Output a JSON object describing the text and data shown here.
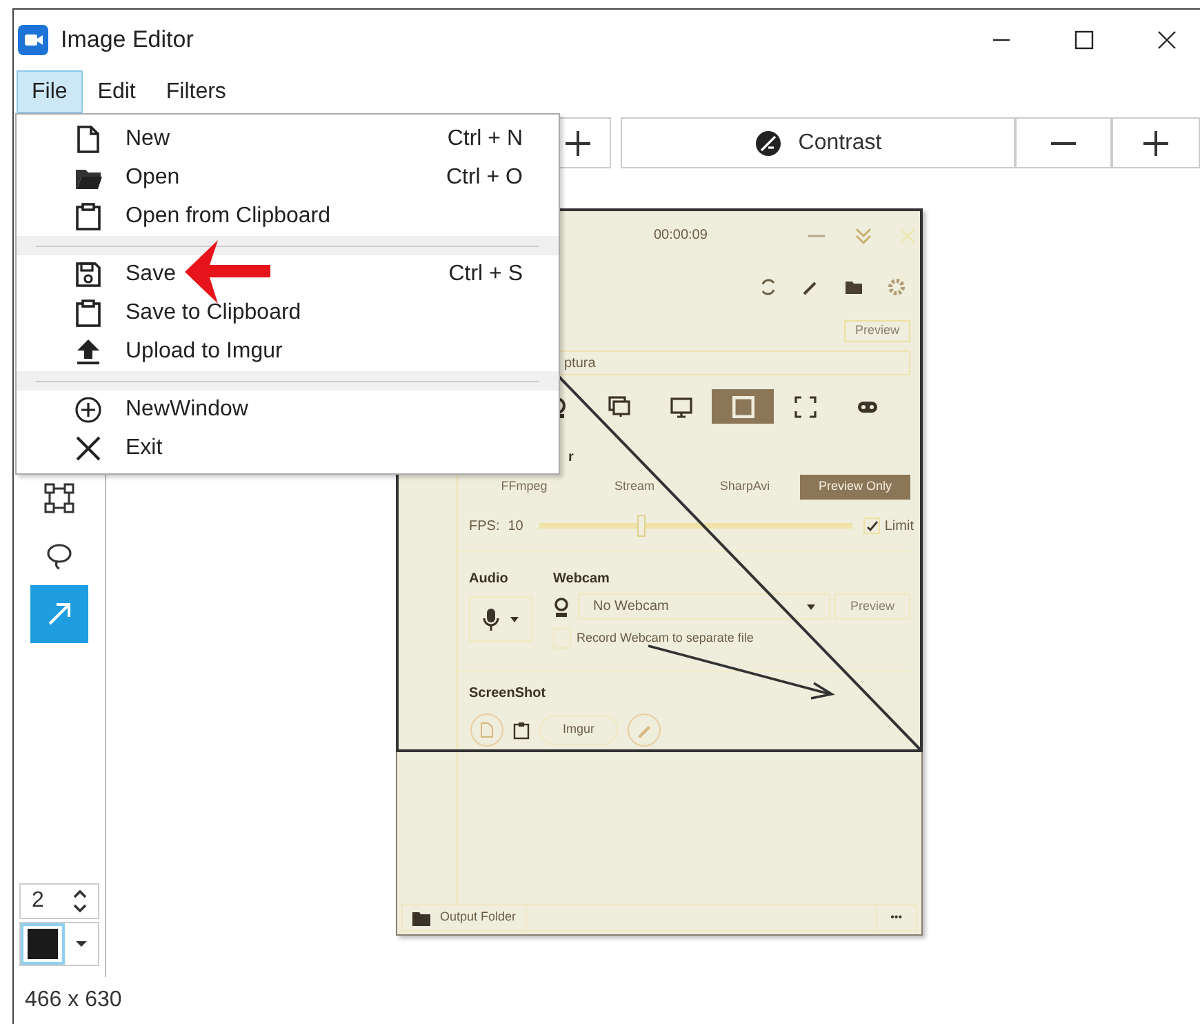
{
  "window": {
    "title": "Image Editor"
  },
  "menu_bar": [
    {
      "label": "File",
      "selected": true
    },
    {
      "label": "Edit",
      "selected": false
    },
    {
      "label": "Filters",
      "selected": false
    }
  ],
  "file_menu": [
    {
      "kind": "item",
      "label": "New",
      "shortcut": "Ctrl + N"
    },
    {
      "kind": "item",
      "label": "Open",
      "shortcut": "Ctrl + O"
    },
    {
      "kind": "item",
      "label": "Open from Clipboard"
    },
    {
      "kind": "separator"
    },
    {
      "kind": "item",
      "label": "Save",
      "shortcut": "Ctrl + S"
    },
    {
      "kind": "item",
      "label": "Save to Clipboard"
    },
    {
      "kind": "item",
      "label": "Upload to Imgur"
    },
    {
      "kind": "separator"
    },
    {
      "kind": "item",
      "label": "NewWindow"
    },
    {
      "kind": "item",
      "label": "Exit"
    }
  ],
  "toolbar": {
    "contrast_label": "Contrast"
  },
  "tools": [
    {
      "selected": false
    },
    {
      "selected": false
    },
    {
      "selected": true
    }
  ],
  "stroke_size": "2",
  "status_bar": "466 x 630",
  "captured_app": {
    "time": "00:00:09",
    "preview_top": "Preview",
    "field_text": "ptura",
    "section_label": "r",
    "sources": [
      {
        "selected": false
      },
      {
        "selected": false
      },
      {
        "selected": false
      },
      {
        "selected": true
      },
      {
        "selected": false
      },
      {
        "selected": false
      }
    ],
    "encoders": [
      {
        "label": "FFmpeg",
        "selected": false
      },
      {
        "label": "Stream",
        "selected": false
      },
      {
        "label": "SharpAvi",
        "selected": false
      },
      {
        "label": "Preview Only",
        "selected": true
      }
    ],
    "fps_label": "FPS:",
    "fps_value": "10",
    "fps_slider": {
      "level": 0.32
    },
    "limit": {
      "label": "Limit",
      "checked": true
    },
    "audio_label": "Audio",
    "webcam_label": "Webcam",
    "webcam_value": "No Webcam",
    "webcam_preview": "Preview",
    "record_separate": {
      "label": "Record Webcam to separate file",
      "checked": false
    },
    "screenshot_label": "ScreenShot",
    "imgur": "Imgur",
    "output_folder": "Output Folder",
    "more": "•••"
  }
}
